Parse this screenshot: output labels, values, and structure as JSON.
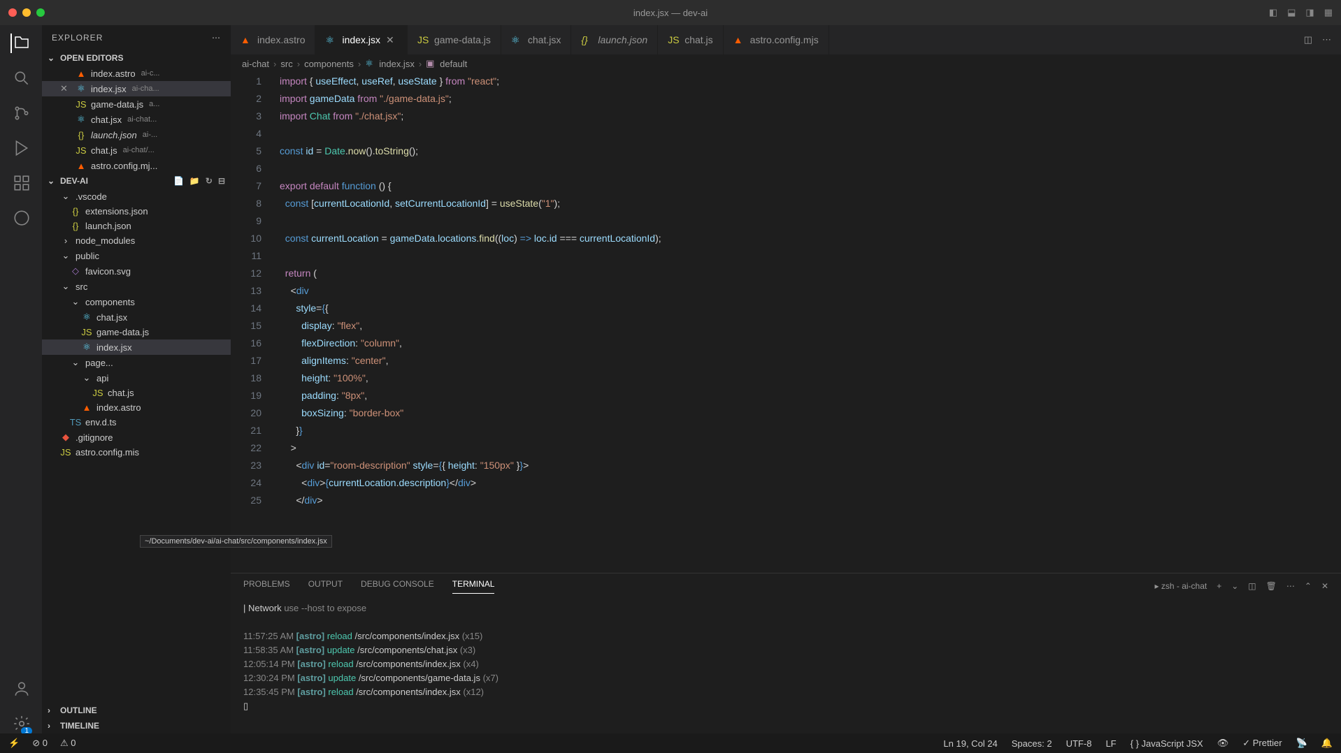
{
  "title": "index.jsx — dev-ai",
  "explorer_label": "EXPLORER",
  "sections": {
    "open_editors": "OPEN EDITORS",
    "project": "DEV-AI",
    "outline": "OUTLINE",
    "timeline": "TIMELINE"
  },
  "open_editors": [
    {
      "icon": "astro",
      "name": "index.astro",
      "hint": "ai-c..."
    },
    {
      "icon": "react",
      "name": "index.jsx",
      "hint": "ai-cha...",
      "active": true
    },
    {
      "icon": "js",
      "name": "game-data.js",
      "hint": "a..."
    },
    {
      "icon": "react",
      "name": "chat.jsx",
      "hint": "ai-chat..."
    },
    {
      "icon": "json",
      "name": "launch.json",
      "hint": "ai-...",
      "ital": true
    },
    {
      "icon": "js",
      "name": "chat.js",
      "hint": "ai-chat/..."
    },
    {
      "icon": "astro",
      "name": "astro.config.mj...",
      "hint": ""
    }
  ],
  "tree": [
    {
      "d": 1,
      "type": "folder-open",
      "name": ".vscode"
    },
    {
      "d": 2,
      "type": "json",
      "name": "extensions.json"
    },
    {
      "d": 2,
      "type": "json",
      "name": "launch.json"
    },
    {
      "d": 1,
      "type": "folder",
      "name": "node_modules"
    },
    {
      "d": 1,
      "type": "folder-open",
      "name": "public"
    },
    {
      "d": 2,
      "type": "svg",
      "name": "favicon.svg"
    },
    {
      "d": 1,
      "type": "folder-open",
      "name": "src"
    },
    {
      "d": 2,
      "type": "folder-open",
      "name": "components"
    },
    {
      "d": 3,
      "type": "react",
      "name": "chat.jsx"
    },
    {
      "d": 3,
      "type": "js",
      "name": "game-data.js"
    },
    {
      "d": 3,
      "type": "react",
      "name": "index.jsx",
      "sel": true
    },
    {
      "d": 2,
      "type": "folder-open",
      "name": "page..."
    },
    {
      "d": 3,
      "type": "folder-open",
      "name": "api"
    },
    {
      "d": 4,
      "type": "js",
      "name": "chat.js"
    },
    {
      "d": 3,
      "type": "astro",
      "name": "index.astro"
    },
    {
      "d": 2,
      "type": "ts",
      "name": "env.d.ts"
    },
    {
      "d": 1,
      "type": "git",
      "name": ".gitignore"
    },
    {
      "d": 1,
      "type": "js",
      "name": "astro.config.mis"
    }
  ],
  "tooltip": "~/Documents/dev-ai/ai-chat/src/components/index.jsx",
  "tabs": [
    {
      "icon": "astro",
      "label": "index.astro"
    },
    {
      "icon": "react",
      "label": "index.jsx",
      "active": true,
      "close": true
    },
    {
      "icon": "js",
      "label": "game-data.js"
    },
    {
      "icon": "react",
      "label": "chat.jsx"
    },
    {
      "icon": "json",
      "label": "launch.json",
      "ital": true
    },
    {
      "icon": "js",
      "label": "chat.js"
    },
    {
      "icon": "astro",
      "label": "astro.config.mjs"
    }
  ],
  "breadcrumbs": [
    "ai-chat",
    "src",
    "components",
    "index.jsx",
    "default"
  ],
  "breadcrumb_icons": [
    "",
    "",
    "",
    "react",
    "cube"
  ],
  "code_lines": 25,
  "panel": {
    "tabs": [
      "PROBLEMS",
      "OUTPUT",
      "DEBUG CONSOLE",
      "TERMINAL"
    ],
    "active": "TERMINAL",
    "shell": "zsh - ai-chat",
    "net_label": "Network",
    "net_hint": "use --host to expose",
    "logs": [
      {
        "t": "11:57:25 AM",
        "a": "reload",
        "p": "/src/components/index.jsx",
        "c": "(x15)"
      },
      {
        "t": "11:58:35 AM",
        "a": "update",
        "p": "/src/components/chat.jsx",
        "c": "(x3)"
      },
      {
        "t": "12:05:14 PM",
        "a": "reload",
        "p": "/src/components/index.jsx",
        "c": "(x4)"
      },
      {
        "t": "12:30:24 PM",
        "a": "update",
        "p": "/src/components/game-data.js",
        "c": "(x7)"
      },
      {
        "t": "12:35:45 PM",
        "a": "reload",
        "p": "/src/components/index.jsx",
        "c": "(x12)"
      }
    ]
  },
  "status": {
    "errors": "0",
    "warnings": "0",
    "pos": "Ln 19, Col 24",
    "spaces": "Spaces: 2",
    "enc": "UTF-8",
    "eol": "LF",
    "lang": "JavaScript JSX",
    "prettier": "Prettier"
  },
  "badge": "1"
}
